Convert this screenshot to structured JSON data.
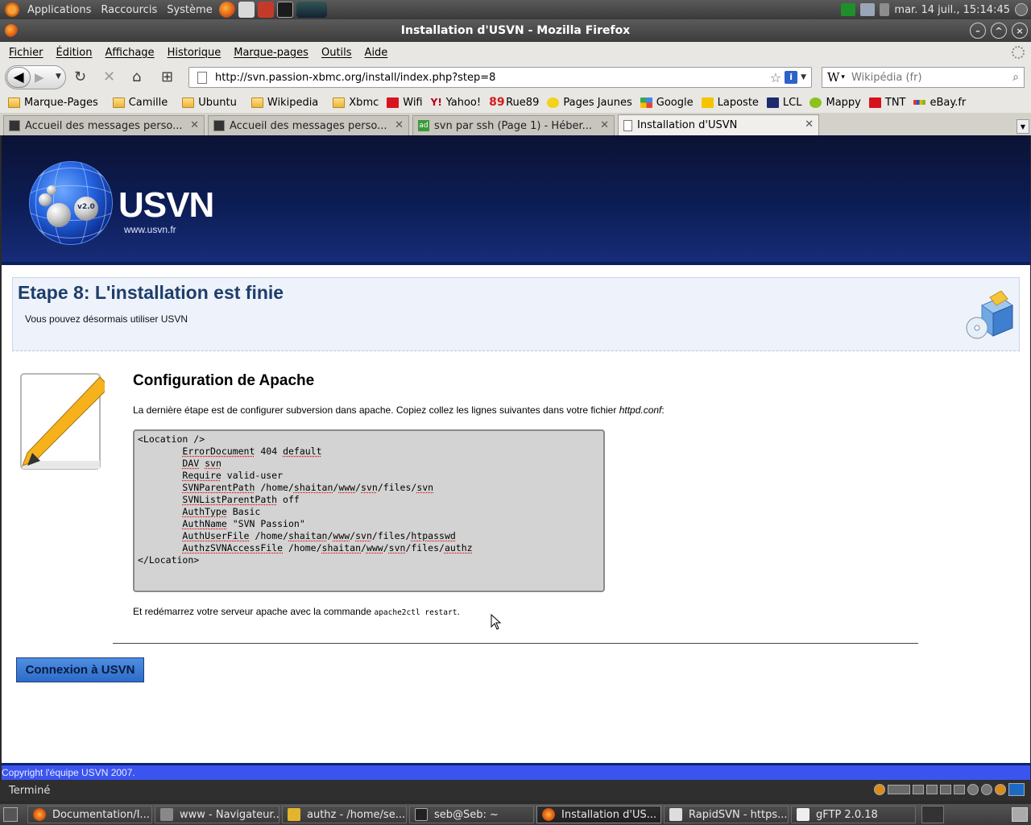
{
  "top_panel": {
    "menus": [
      "Applications",
      "Raccourcis",
      "Système"
    ],
    "clock": "mar. 14 juil., 15:14:45"
  },
  "window": {
    "title": "Installation d'USVN - Mozilla Firefox"
  },
  "menubar": [
    "Fichier",
    "Édition",
    "Affichage",
    "Historique",
    "Marque-pages",
    "Outils",
    "Aide"
  ],
  "navbar": {
    "url": "http://svn.passion-xbmc.org/install/index.php?step=8",
    "search_placeholder": "Wikipédia (fr)"
  },
  "bookmarks": [
    "Marque-Pages",
    "Camille",
    "Ubuntu",
    "Wikipedia",
    "Xbmc",
    "Wifi",
    "Yahoo!",
    "Rue89",
    "Pages Jaunes",
    "Google",
    "Laposte",
    "LCL",
    "Mappy",
    "TNT",
    "eBay.fr"
  ],
  "tabs": [
    "Accueil des messages perso...",
    "Accueil des messages perso...",
    "svn par ssh (Page 1) - Héber...",
    "Installation d'USVN"
  ],
  "page": {
    "brand": "USVN",
    "brand_site": "www.usvn.fr",
    "version_badge": "v2.0",
    "step_title": "Etape 8: L'installation est finie",
    "step_subtitle": "Vous pouvez désormais utiliser USVN",
    "section_title": "Configuration de Apache",
    "intro": "La dernière étape est de configurer subversion dans apache. Copiez collez les lignes suivantes dans votre fichier ",
    "intro_file": "httpd.conf",
    "intro_end": ":",
    "code_lines": [
      "<Location />",
      "\tErrorDocument 404 default",
      "\tDAV svn",
      "\tRequire valid-user",
      "\tSVNParentPath /home/shaitan/www/svn/files/svn",
      "\tSVNListParentPath off",
      "\tAuthType Basic",
      "\tAuthName \"SVN Passion\"",
      "\tAuthUserFile /home/shaitan/www/svn/files/htpasswd",
      "\tAuthzSVNAccessFile /home/shaitan/www/svn/files/authz",
      "</Location>"
    ],
    "restart_text": "Et redémarrez votre serveur apache avec la commande ",
    "restart_cmd": "apache2ctl restart",
    "restart_end": ".",
    "connect_button": "Connexion à USVN",
    "footer": "Copyright l'équipe USVN 2007."
  },
  "statusbar": {
    "status": "Terminé"
  },
  "taskbar": [
    "Documentation/I...",
    "www - Navigateur...",
    "authz - /home/se...",
    "seb@Seb: ~",
    "Installation d'US...",
    "RapidSVN - https...",
    "gFTP 2.0.18"
  ],
  "colors": {
    "banner": "#0c1d55",
    "step_title": "#1e3d6b",
    "connect_button": "#2d6bc9",
    "footer": "#3b54f0"
  }
}
